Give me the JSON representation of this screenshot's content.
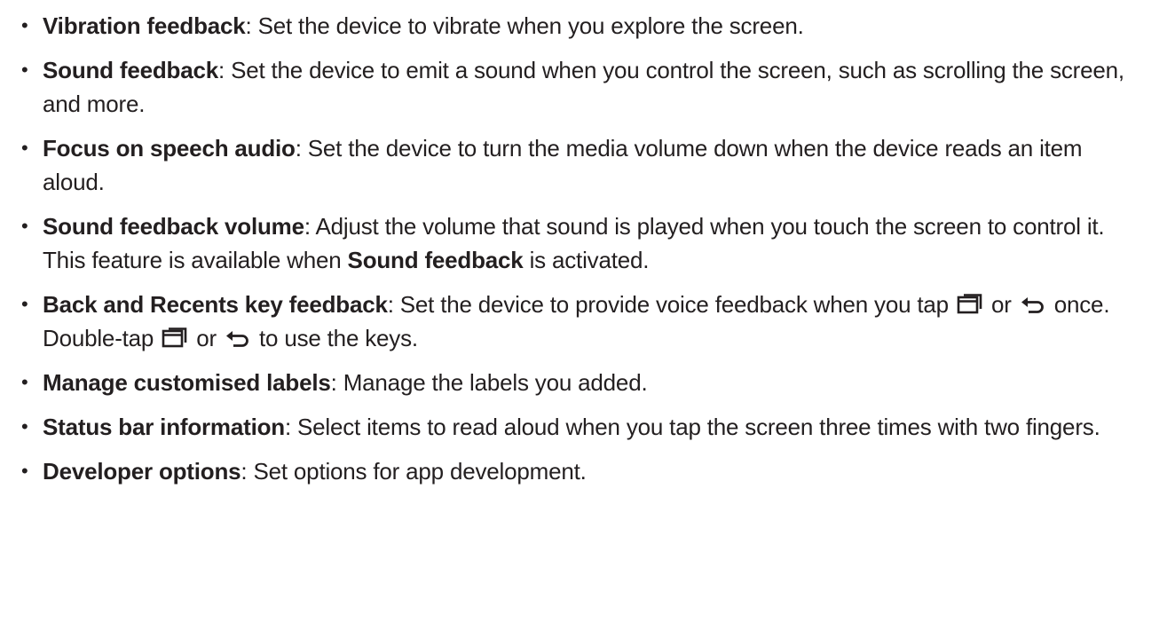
{
  "items": [
    {
      "term": "Vibration feedback",
      "desc": ": Set the device to vibrate when you explore the screen."
    },
    {
      "term": "Sound feedback",
      "desc": ": Set the device to emit a sound when you control the screen, such as scrolling the screen, and more."
    },
    {
      "term": "Focus on speech audio",
      "desc": ": Set the device to turn the media volume down when the device reads an item aloud."
    },
    {
      "term": "Sound feedback volume",
      "desc": ": Adjust the volume that sound is played when you touch the screen to control it. This feature is available when ",
      "desc_bold": "Sound feedback",
      "desc_tail": " is activated."
    },
    {
      "term": "Back and Recents key feedback",
      "desc_1": ": Set the device to provide voice feedback when you tap ",
      "or_1": " or ",
      "desc_2": " once. Double-tap ",
      "or_2": " or ",
      "desc_3": " to use the keys.",
      "icons": [
        "recents-key-icon",
        "back-key-icon"
      ]
    },
    {
      "term": "Manage customised labels",
      "desc": ": Manage the labels you added."
    },
    {
      "term": "Status bar information",
      "desc": ": Select items to read aloud when you tap the screen three times with two fingers."
    },
    {
      "term": "Developer options",
      "desc": ": Set options for app development."
    }
  ],
  "bullet": "•"
}
